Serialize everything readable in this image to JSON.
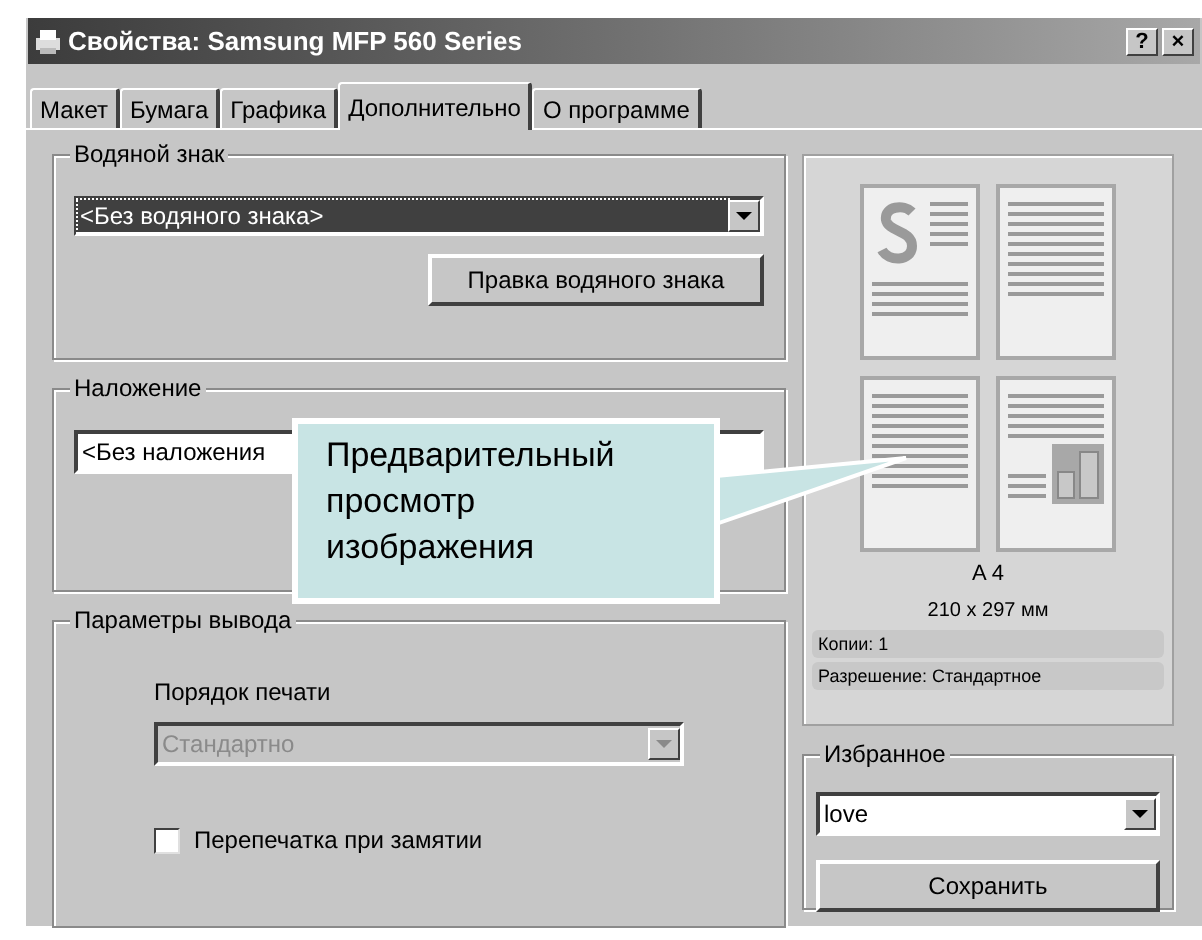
{
  "window": {
    "title": "Свойства: Samsung MFP 560 Series",
    "buttons": [
      "?",
      "×"
    ]
  },
  "tabs": [
    {
      "label": "Макет",
      "selected": false
    },
    {
      "label": "Бумага",
      "selected": false
    },
    {
      "label": "Графика",
      "selected": false
    },
    {
      "label": "Дополнительно",
      "selected": true
    },
    {
      "label": "О программе",
      "selected": false
    }
  ],
  "watermark": {
    "label": "Водяной знак",
    "value": "<Без водяного знака>",
    "button": "Правка водяного знака"
  },
  "overlay": {
    "label": "Наложение",
    "value": "<Без наложения"
  },
  "output": {
    "label": "Параметры вывода",
    "print_order": {
      "label": "Порядок печати",
      "value": "Стандартно",
      "disabled": true
    },
    "reprint": {
      "label": "Перепечатка при замятии",
      "checked": false
    }
  },
  "preview": {
    "paper": "A 4",
    "size": "210 x 297 мм",
    "copies": "Копии: 1",
    "resolution": "Разрешение: Стандартное"
  },
  "favorites": {
    "label": "Избранное",
    "value": "love",
    "button": "Сохранить"
  },
  "callout": {
    "text": "Предварительный просмотр изображения"
  }
}
